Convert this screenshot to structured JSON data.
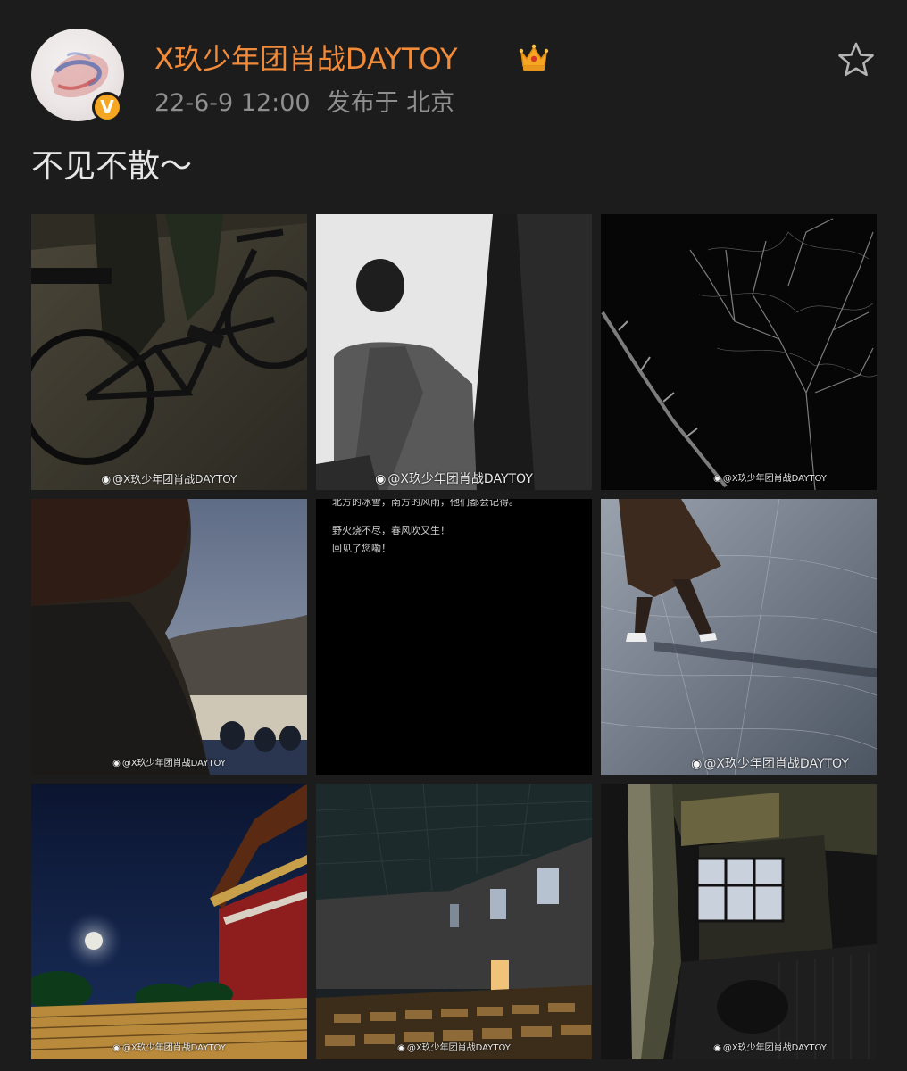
{
  "post": {
    "username": "X玖少年团肖战DAYTOY",
    "date": "22-6-9 12:00",
    "location": "发布于 北京",
    "text": "不见不散～",
    "verified_badge": "V"
  },
  "icons": {
    "crown": "crown-icon",
    "star": "star-outline-icon",
    "verified": "verified-badge-icon",
    "weibo": "weibo-logo-icon"
  },
  "colors": {
    "username": "#f28b39",
    "meta": "#8f8f8f",
    "background": "#1c1c1c",
    "verified": "#f5a623"
  },
  "photos": {
    "watermark": "@X玖少年团肖战DAYTOY",
    "text_photo_lines": [
      "北方的冰雪，南方的风雨，他们都会记得。",
      "野火烧不尽，春风吹又生！",
      "回见了您嘞！"
    ]
  }
}
